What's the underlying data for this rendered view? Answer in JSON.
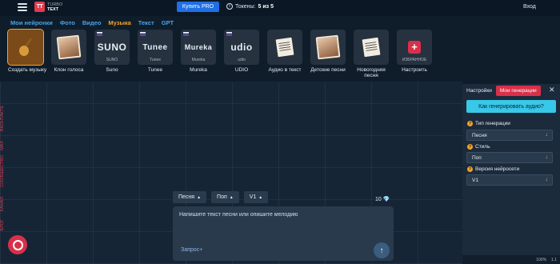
{
  "header": {
    "logo_line1": "TURBO",
    "logo_line2": "TEXT",
    "logo_mark": "TT",
    "buy_label": "Купить PRO",
    "tokens_label": "Токены:",
    "tokens_value": "5 из 5",
    "login_label": "Вход"
  },
  "nav": {
    "tabs": [
      {
        "label": "Мои нейронки",
        "active": false
      },
      {
        "label": "Фото",
        "active": false
      },
      {
        "label": "Видео",
        "active": false
      },
      {
        "label": "Музыка",
        "active": true
      },
      {
        "label": "Текст",
        "active": false
      },
      {
        "label": "GPT",
        "active": false
      }
    ]
  },
  "tools": [
    {
      "label": "Создать музыку",
      "icon": "guitar-notes-icon",
      "active": true
    },
    {
      "label": "Клон голоса",
      "icon": "portrait-mic-icon",
      "active": false
    },
    {
      "label": "Suno",
      "brand": "SUNO",
      "sub": "SUNO",
      "icon": "suno-logo"
    },
    {
      "label": "Tunee",
      "brand": "Tunee",
      "sub": "Tunee",
      "icon": "tunee-logo"
    },
    {
      "label": "Mureka",
      "brand": "Mureka",
      "sub": "Mureka",
      "icon": "mureka-logo"
    },
    {
      "label": "UDIO",
      "brand": "udio",
      "sub": "udio",
      "icon": "udio-logo"
    },
    {
      "label": "Аудио в текст",
      "icon": "paper-guitar-icon"
    },
    {
      "label": "Детские песни",
      "icon": "child-portrait-icon"
    },
    {
      "label": "Новогодняя песня",
      "icon": "paper-guitar-icon"
    },
    {
      "label": "Настроить",
      "sub": "ИЗБРАННОЕ",
      "icon": "plus-icon"
    }
  ],
  "side_links": [
    "ВКОНТАКТЕ",
    "MAX",
    "СООБЩЕСТВО",
    "КАНАЛ",
    "БЛОГ"
  ],
  "composer": {
    "chips": [
      {
        "label": "Песня"
      },
      {
        "label": "Поп"
      },
      {
        "label": "V1"
      }
    ],
    "credit_value": "10",
    "placeholder": "Напишите текст песни или опишите мелодию",
    "request_label": "Запрос+"
  },
  "panel": {
    "tab_settings": "Настройки",
    "tab_generations": "Мои генерации",
    "help_button": "Как генерировать аудио?",
    "fields": [
      {
        "label": "Тип генерации",
        "value": "Песня"
      },
      {
        "label": "Стиль",
        "value": "Поп"
      },
      {
        "label": "Версия нейросети",
        "value": "V1"
      }
    ]
  },
  "status_bar": {
    "zoom": "100%",
    "version": "1.1"
  },
  "colors": {
    "accent_orange": "#f5a524",
    "brand_red": "#d9304a",
    "link_blue": "#4aa3e8",
    "buy_blue": "#1f6fe5",
    "help_cyan": "#38c8e8"
  }
}
